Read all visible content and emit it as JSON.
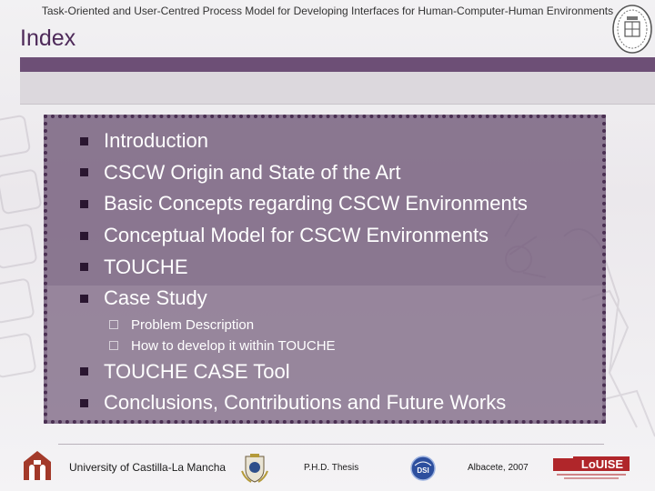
{
  "header": {
    "title": "Task-Oriented and User-Centred Process Model for Developing Interfaces for Human-Computer-Human Environments"
  },
  "page": {
    "title": "Index"
  },
  "agenda": {
    "items": [
      {
        "label": "Introduction"
      },
      {
        "label": "CSCW Origin and State of the Art"
      },
      {
        "label": "Basic Concepts regarding CSCW Environments"
      },
      {
        "label": "Conceptual Model for CSCW Environments"
      },
      {
        "label": "TOUCHE"
      },
      {
        "label": "Case Study"
      },
      {
        "label": "TOUCHE CASE Tool"
      },
      {
        "label": "Conclusions, Contributions and Future Works"
      }
    ],
    "case_study_subitems": [
      {
        "label": "Problem Description"
      },
      {
        "label": "How to develop it within TOUCHE"
      }
    ]
  },
  "footer": {
    "university": "University of Castilla-La Mancha",
    "thesis": "P.H.D. Thesis",
    "place_date": "Albacete, 2007",
    "dsi_logo_text": "DSI",
    "louise_logo_text": "LoUISE"
  },
  "colors": {
    "accent_dark": "#6d4f76",
    "title_purple": "#4e2a5a",
    "content_bg": "#6e5676",
    "bullet": "#2a1630"
  },
  "icons": {
    "university_seal": "university-seal-icon",
    "cathedral_logo": "uclm-logo-icon",
    "crest_logo": "crest-logo-icon",
    "dsi_logo": "dsi-logo-icon",
    "louise_logo": "louise-logo-icon"
  }
}
